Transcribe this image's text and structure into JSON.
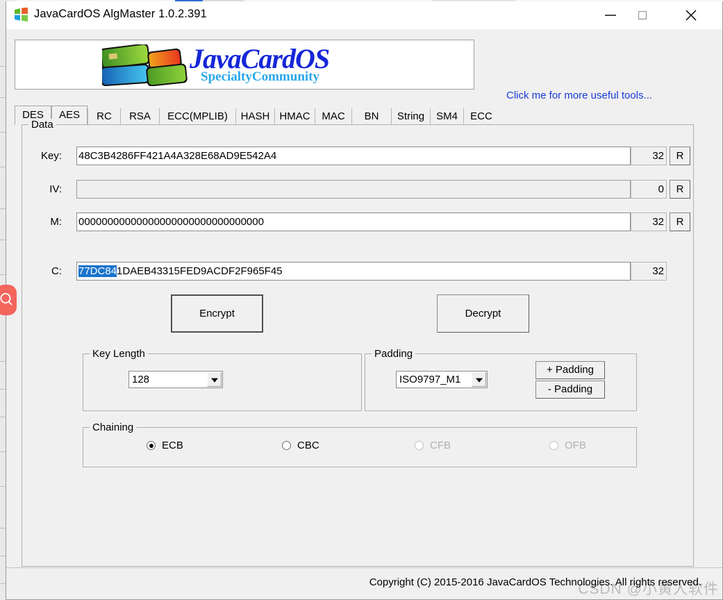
{
  "window": {
    "title": "JavaCardOS AlgMaster 1.0.2.391",
    "icon": "windows-logo-icon",
    "minimize_label": "Minimize",
    "maximize_label": "Maximize",
    "close_label": "Close"
  },
  "banner": {
    "logo_main": "JavaCardOS",
    "logo_sub": "SpecialtyCommunity",
    "tools_link": "Click me for more useful tools..."
  },
  "tabs": [
    {
      "label": "DES",
      "selected": false
    },
    {
      "label": "AES",
      "selected": true
    },
    {
      "label": "RC",
      "selected": false
    },
    {
      "label": "RSA",
      "selected": false
    },
    {
      "label": "ECC(MPLIB)",
      "selected": false
    },
    {
      "label": "HASH",
      "selected": false
    },
    {
      "label": "HMAC",
      "selected": false
    },
    {
      "label": "MAC",
      "selected": false
    },
    {
      "label": "BN",
      "selected": false
    },
    {
      "label": "String",
      "selected": false
    },
    {
      "label": "SM4",
      "selected": false
    },
    {
      "label": "ECC",
      "selected": false
    }
  ],
  "data_group": {
    "legend": "Data",
    "rows": [
      {
        "label": "Key:",
        "value": "48C3B4286FF421A4A328E68AD9E542A4",
        "count": "32",
        "random_button": "R",
        "disabled": false,
        "selection": ""
      },
      {
        "label": "IV:",
        "value": "",
        "count": "0",
        "random_button": "R",
        "disabled": true,
        "selection": ""
      },
      {
        "label": "M:",
        "value": "00000000000000000000000000000000",
        "count": "32",
        "random_button": "R",
        "disabled": false,
        "selection": ""
      },
      {
        "label": "C:",
        "value": "77DC841DAEB43315FED9ACDF2F965F45",
        "count": "32",
        "random_button": "",
        "disabled": false,
        "selection": "77DC84",
        "rest": "1DAEB43315FED9ACDF2F965F45"
      }
    ]
  },
  "actions": {
    "encrypt": "Encrypt",
    "decrypt": "Decrypt"
  },
  "key_length": {
    "legend": "Key Length",
    "selected": "128"
  },
  "padding": {
    "legend": "Padding",
    "selected": "ISO9797_M1",
    "add_button": "+ Padding",
    "remove_button": "- Padding"
  },
  "chaining": {
    "legend": "Chaining",
    "options": [
      {
        "label": "ECB",
        "selected": true,
        "disabled": false
      },
      {
        "label": "CBC",
        "selected": false,
        "disabled": false
      },
      {
        "label": "CFB",
        "selected": false,
        "disabled": true
      },
      {
        "label": "OFB",
        "selected": false,
        "disabled": true
      }
    ]
  },
  "footer": {
    "copyright": "Copyright (C) 2015-2016 JavaCardOS Technologies. All rights reserved."
  },
  "watermark": {
    "text": "CSDN @小黄人软件"
  },
  "overlay": {
    "search_chip": "search-icon"
  },
  "colors": {
    "accent_link": "#1a3bd6",
    "selection": "#1874cd",
    "chip": "#f4655c",
    "window_bg": "#f0f0f0"
  }
}
